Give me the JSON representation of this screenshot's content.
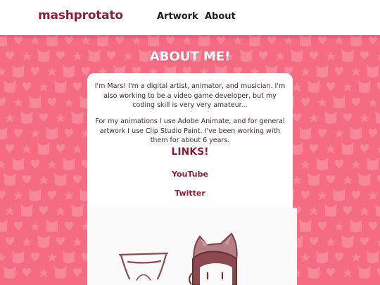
{
  "header": {
    "logo": "mashprotato",
    "nav": [
      {
        "label": "Artwork"
      },
      {
        "label": "About"
      }
    ]
  },
  "page": {
    "title": "ABOUT ME!"
  },
  "bio": {
    "paragraph_1": "I'm Mars! I'm a digital artist, animator, and musician. I'm also working to be a video game developer, but my coding skill is very very amateur...",
    "paragraph_2": "For my animations I use Adobe Animate, and for general artwork I use Clip Studio Paint. I've been working with them for about 6 years."
  },
  "links": {
    "title": "LINKS!",
    "items": [
      {
        "label": "YouTube"
      },
      {
        "label": "Twitter"
      }
    ]
  },
  "colors": {
    "background": "#f56b82",
    "pattern": "#f7889a",
    "accent": "#8b1f3a",
    "header_bg": "#ffffff",
    "card_bg": "#ffffff"
  },
  "decor": {
    "pattern_icons": [
      "cat-head-icon",
      "heart-icon",
      "star-icon"
    ],
    "illustration": [
      "cup-drawing",
      "cat-character-drawing"
    ]
  }
}
